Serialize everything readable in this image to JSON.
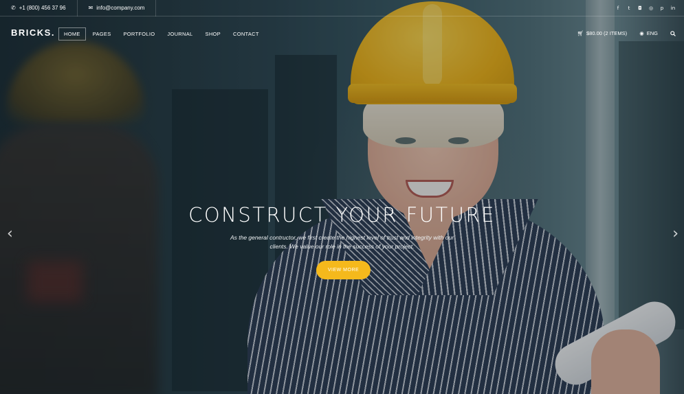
{
  "topbar": {
    "phone": "+1 (800) 456 37 96",
    "email": "info@company.com",
    "phone_icon": "phone-icon",
    "email_icon": "envelope-icon",
    "social": [
      {
        "name": "facebook-icon",
        "glyph": "f"
      },
      {
        "name": "twitter-icon",
        "glyph": "t"
      },
      {
        "name": "instagram-icon",
        "glyph": "◘"
      },
      {
        "name": "dribbble-icon",
        "glyph": "◎"
      },
      {
        "name": "pinterest-icon",
        "glyph": "p"
      },
      {
        "name": "linkedin-icon",
        "glyph": "in"
      }
    ]
  },
  "nav": {
    "logo": "BRICKS.",
    "items": [
      "HOME",
      "PAGES",
      "PORTFOLIO",
      "JOURNAL",
      "SHOP",
      "CONTACT"
    ],
    "active": "HOME",
    "cart": "$80.00 (2 ITEMS)",
    "cart_icon": "cart-icon",
    "language": "ENG",
    "language_icon": "globe-icon",
    "search_icon": "search-icon"
  },
  "hero": {
    "headline": "CONSTRUCT YOUR FUTURE",
    "subtext": "As the general contructor, we first create the highest level of trust and integrity with our clients. We value our role in the success of your project.",
    "cta": "VIEW MORE",
    "prev_arrow": "‹",
    "next_arrow": "›"
  },
  "colors": {
    "accent": "#f5b91c",
    "helmet": "#f2b316"
  }
}
